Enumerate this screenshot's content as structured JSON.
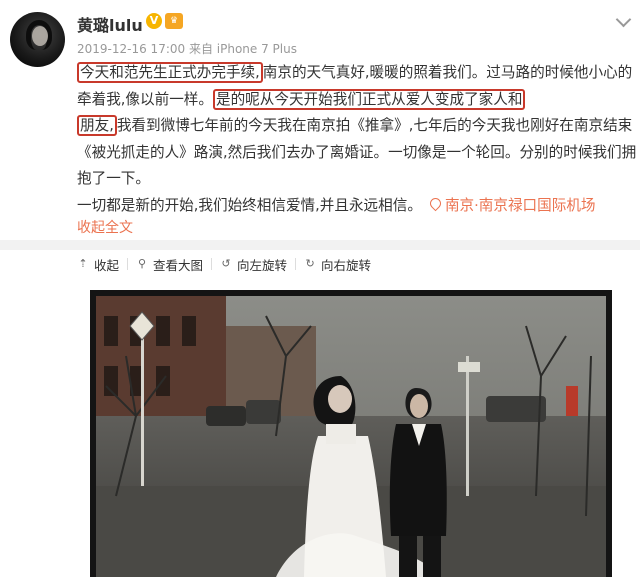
{
  "user": {
    "name": "黄璐lulu",
    "verified_badge": "V",
    "meta": "2019-12-16 17:00 来自 iPhone 7 Plus"
  },
  "post": {
    "highlight_1": "今天和范先生正式办完手续,",
    "text_1": "南京的天气真好,暖暖的照着我们。过马路的时候他小心的牵着我,像以前一样。",
    "highlight_2a": "是的呢从今天开始我们正式从爱人变成了家人和",
    "highlight_2b": "朋友,",
    "text_2": "我看到微博七年前的今天我在南京拍《推拿》,七年后的今天我也刚好在南京结束《被光抓走的人》路演,然后我们去办了离婚证。一切像是一个轮回。分别的时候我们拥抱了一下。",
    "text_3": "一切都是新的开始,我们始终相信爱情,并且永远相信。",
    "location": "南京·南京禄口国际机场",
    "collapse_label": "收起全文"
  },
  "toolbar": {
    "collapse": "收起",
    "view_large": "查看大图",
    "rotate_left": "向左旋转",
    "rotate_right": "向右旋转"
  },
  "colors": {
    "accent": "#eb7350",
    "highlight_box": "#c8392b",
    "divider": "#f2f2f2"
  }
}
